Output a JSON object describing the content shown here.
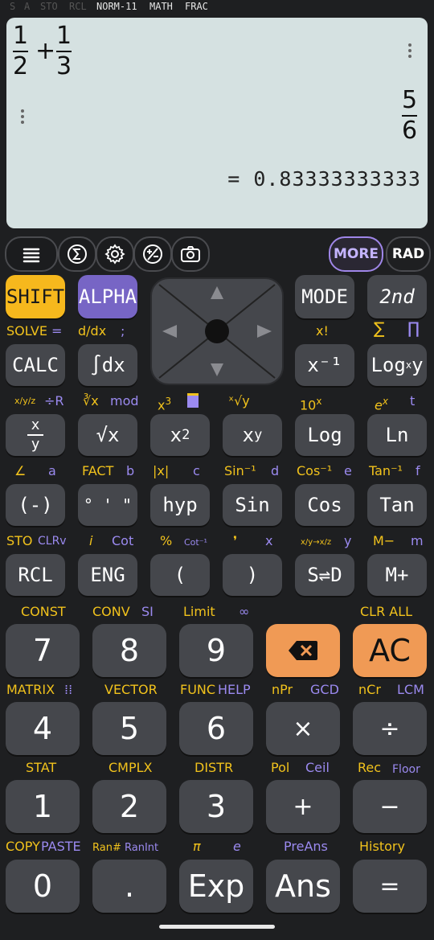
{
  "status": {
    "items": [
      "S",
      "A",
      "STO",
      "RCL",
      "NORM-11",
      "MATH",
      "FRAC"
    ]
  },
  "display": {
    "expr": {
      "n1": "1",
      "d1": "2",
      "op": "+",
      "n2": "1",
      "d2": "3"
    },
    "answer": {
      "num": "5",
      "den": "6"
    },
    "decimal": "= 0.83333333333"
  },
  "toolbar": {
    "more": "MORE",
    "rad": "RAD"
  },
  "icons": [
    "menu-icon",
    "sigma-icon",
    "settings-icon",
    "plus-minus-icon",
    "camera-icon"
  ],
  "keys": {
    "shift": "SHIFT",
    "alpha": "ALPHA",
    "mode": "MODE",
    "second": "2nd",
    "calc": "CALC",
    "integral": "∫dx",
    "inverse": "x⁻¹",
    "logxy_main": "Log",
    "logxy_sub": "x",
    "logxy_tail": "y",
    "frac_top": "x",
    "frac_bot": "y",
    "sqrt": "√x",
    "square_base": "x",
    "square_exp": "2",
    "power_base": "x",
    "power_exp": "y",
    "log": "Log",
    "ln": "Ln",
    "neg": "(-)",
    "deg": "° ' \"",
    "hyp": "hyp",
    "sin": "Sin",
    "cos": "Cos",
    "tan": "Tan",
    "rcl": "RCL",
    "eng": "ENG",
    "lparen": "(",
    "rparen": ")",
    "sd": "S⇌D",
    "mplus": "M+",
    "k7": "7",
    "k8": "8",
    "k9": "9",
    "ac": "AC",
    "k4": "4",
    "k5": "5",
    "k6": "6",
    "mul": "×",
    "div": "÷",
    "k1": "1",
    "k2": "2",
    "k3": "3",
    "add": "+",
    "sub": "−",
    "k0": "0",
    "dot": ".",
    "exp": "Exp",
    "ans": "Ans",
    "eq": "="
  },
  "labels": {
    "solve": "SOLVE",
    "solve_eq": "=",
    "ddx": "d/dx",
    "semi": ";",
    "xfact": "x!",
    "sum": "∑",
    "prod": "∏",
    "xyz": "x/y/z",
    "divr": "÷R",
    "cbrt": "∛x",
    "mod": "mod",
    "cube_base": "x",
    "cube_exp": "3",
    "xroot": "ˣ√y",
    "ten_base": "10",
    "ten_exp": "x",
    "e_base": "e",
    "e_exp": "x",
    "t": "t",
    "angle": "∠",
    "a": "a",
    "fact": "FACT",
    "b": "b",
    "abs": "|x|",
    "c": "c",
    "asin": "Sin⁻¹",
    "d": "d",
    "acos": "Cos⁻¹",
    "e": "e",
    "atan": "Tan⁻¹",
    "f": "f",
    "sto": "STO",
    "clrv": "CLRv",
    "i": "i",
    "cot": "Cot",
    "pct": "%",
    "acot": "Cot⁻¹",
    "comma": "❜",
    "x": "x",
    "conv3": "x/y→x/z",
    "yv": "y",
    "mminus": "M−",
    "m": "m",
    "const": "CONST",
    "conv": "CONV",
    "si": "SI",
    "limit": "Limit",
    "inf": "∞",
    "clrall": "CLR ALL",
    "matrix": "MATRIX",
    "vector": "VECTOR",
    "func": "FUNC",
    "help": "HELP",
    "npr": "nPr",
    "gcd": "GCD",
    "ncr": "nCr",
    "lcm": "LCM",
    "stat": "STAT",
    "cmplx": "CMPLX",
    "distr": "DISTR",
    "pol": "Pol",
    "ceil": "Ceil",
    "rec": "Rec",
    "floor": "Floor",
    "copy": "COPY",
    "paste": "PASTE",
    "rannum": "Ran#",
    "ranint": "RanInt",
    "pi": "π",
    "ev": "e",
    "preans": "PreAns",
    "history": "History"
  },
  "colors": {
    "shift": "#f6b81d",
    "alpha": "#7765c5",
    "accent_orange": "#f09a55",
    "display_bg": "#d5e1e1"
  }
}
